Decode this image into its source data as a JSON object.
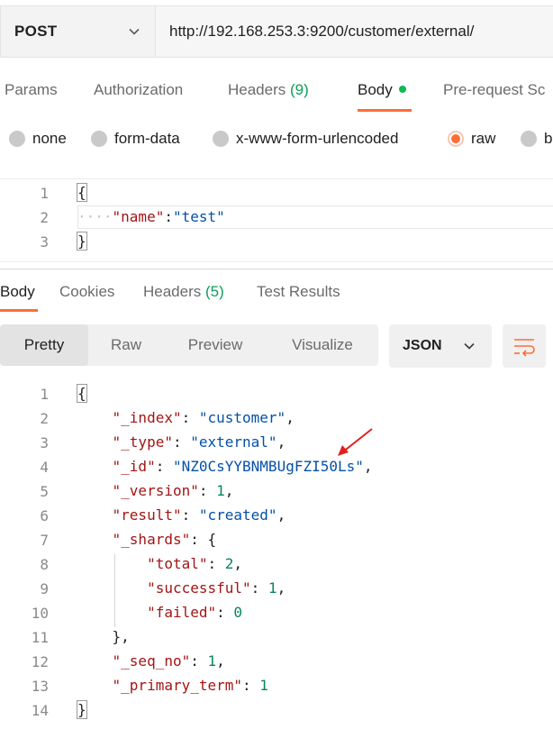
{
  "request": {
    "method": "POST",
    "url": "http://192.168.253.3:9200/customer/external/"
  },
  "request_tabs": [
    {
      "label": "Params"
    },
    {
      "label": "Authorization"
    },
    {
      "label": "Headers",
      "count": "(9)"
    },
    {
      "label": "Body"
    },
    {
      "label": "Pre-request Sc"
    }
  ],
  "body_types": [
    {
      "label": "none"
    },
    {
      "label": "form-data"
    },
    {
      "label": "x-www-form-urlencoded"
    },
    {
      "label": "raw"
    },
    {
      "label": "b"
    }
  ],
  "request_body": {
    "line_numbers": [
      "1",
      "2",
      "3"
    ],
    "open_brace": "{",
    "indent": "····",
    "key": "\"name\"",
    "colon": ":",
    "value": "\"test\"",
    "close_brace": "}"
  },
  "response_tabs": [
    {
      "label": "Body"
    },
    {
      "label": "Cookies"
    },
    {
      "label": "Headers",
      "count": "(5)"
    },
    {
      "label": "Test Results"
    }
  ],
  "view_modes": [
    "Pretty",
    "Raw",
    "Preview",
    "Visualize"
  ],
  "format": "JSON",
  "response_body": {
    "line_numbers": [
      "1",
      "2",
      "3",
      "4",
      "5",
      "6",
      "7",
      "8",
      "9",
      "10",
      "11",
      "12",
      "13",
      "14"
    ],
    "open_brace": "{",
    "close_brace": "}",
    "shards_close": "},",
    "index_key": "\"_index\"",
    "index_val": "\"customer\"",
    "type_key": "\"_type\"",
    "type_val": "\"external\"",
    "id_key": "\"_id\"",
    "id_val": "\"NZ0CsYYBNMBUgFZI50Ls\"",
    "version_key": "\"_version\"",
    "version_val": "1",
    "result_key": "\"result\"",
    "result_val": "\"created\"",
    "shards_key": "\"_shards\"",
    "total_key": "\"total\"",
    "total_val": "2",
    "successful_key": "\"successful\"",
    "successful_val": "1",
    "failed_key": "\"failed\"",
    "failed_val": "0",
    "seq_key": "\"_seq_no\"",
    "seq_val": "1",
    "primary_key": "\"_primary_term\"",
    "primary_val": "1"
  },
  "colors": {
    "accent": "#ff6c37",
    "count_green": "#0f9d58",
    "key_red": "#a31515",
    "string_blue": "#0451a5",
    "number_green": "#098658",
    "annotation_arrow": "#e0201c"
  },
  "icons": [
    "chevron-down-icon",
    "wrap-lines-icon",
    "annotation-arrow"
  ]
}
